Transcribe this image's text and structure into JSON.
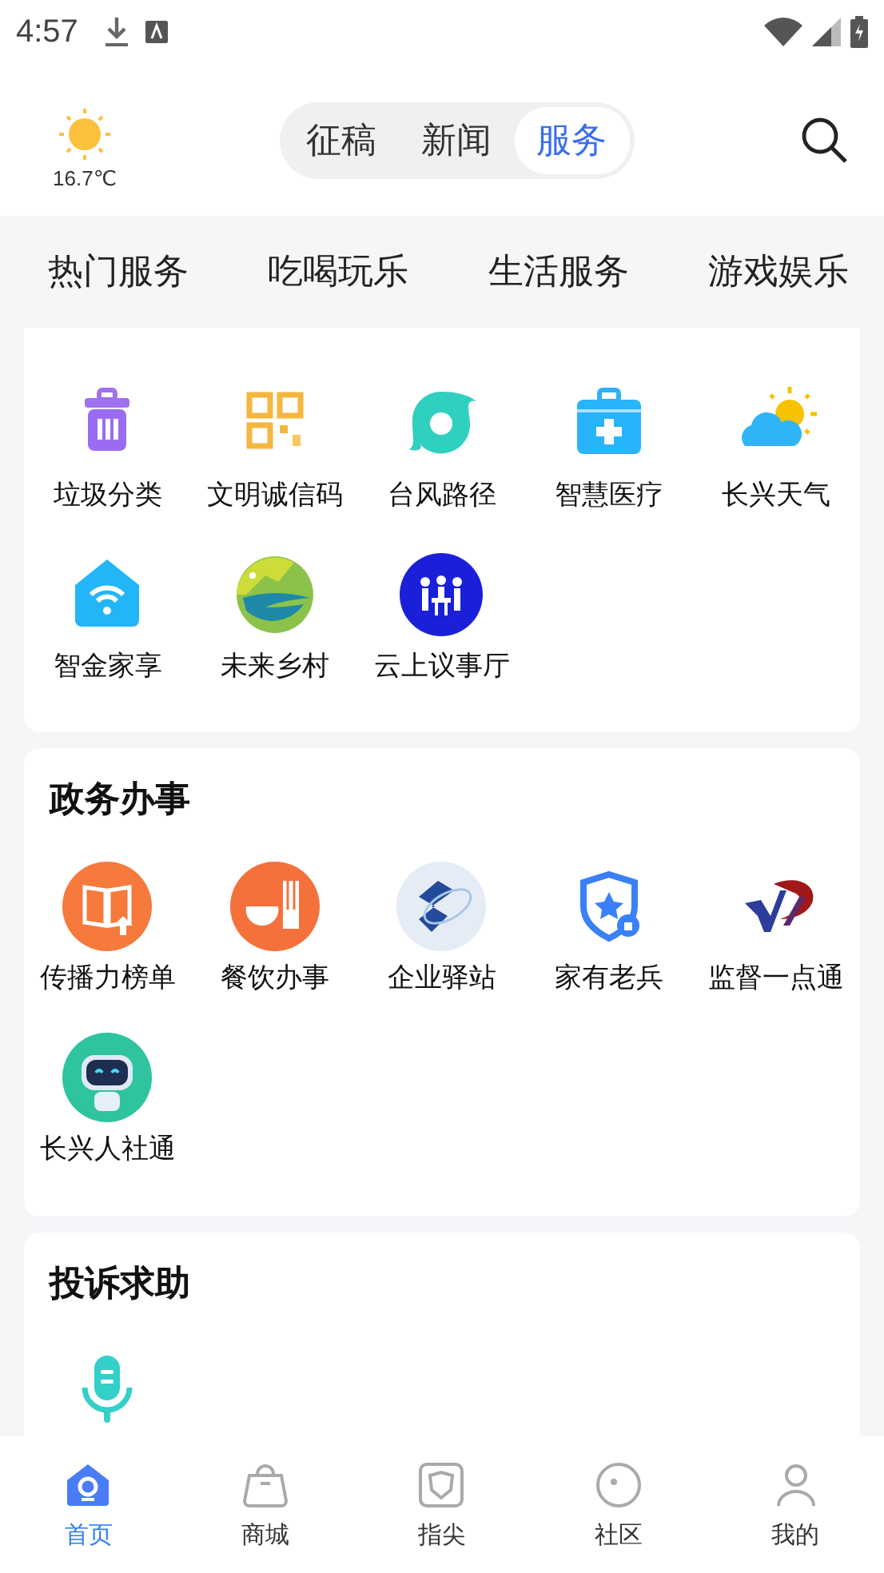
{
  "status_bar": {
    "time": "4:57"
  },
  "header": {
    "temperature": "16.7℃",
    "tabs": [
      {
        "label": "征稿",
        "selected": false
      },
      {
        "label": "新闻",
        "selected": false
      },
      {
        "label": "服务",
        "selected": true
      }
    ]
  },
  "category_tabs": [
    "热门服务",
    "吃喝玩乐",
    "生活服务",
    "游戏娱乐"
  ],
  "sections": [
    {
      "items": [
        {
          "label": "垃圾分类"
        },
        {
          "label": "文明诚信码"
        },
        {
          "label": "台风路径"
        },
        {
          "label": "智慧医疗"
        },
        {
          "label": "长兴天气"
        },
        {
          "label": "智金家享"
        },
        {
          "label": "未来乡村"
        },
        {
          "label": "云上议事厅"
        }
      ]
    },
    {
      "title": "政务办事",
      "items": [
        {
          "label": "传播力榜单"
        },
        {
          "label": "餐饮办事"
        },
        {
          "label": "企业驿站"
        },
        {
          "label": "家有老兵"
        },
        {
          "label": "监督一点通"
        },
        {
          "label": "长兴人社通"
        }
      ]
    },
    {
      "title": "投诉求助"
    }
  ],
  "bottom_nav": [
    {
      "label": "首页",
      "selected": true
    },
    {
      "label": "商城",
      "selected": false
    },
    {
      "label": "指尖",
      "selected": false
    },
    {
      "label": "社区",
      "selected": false
    },
    {
      "label": "我的",
      "selected": false
    }
  ]
}
